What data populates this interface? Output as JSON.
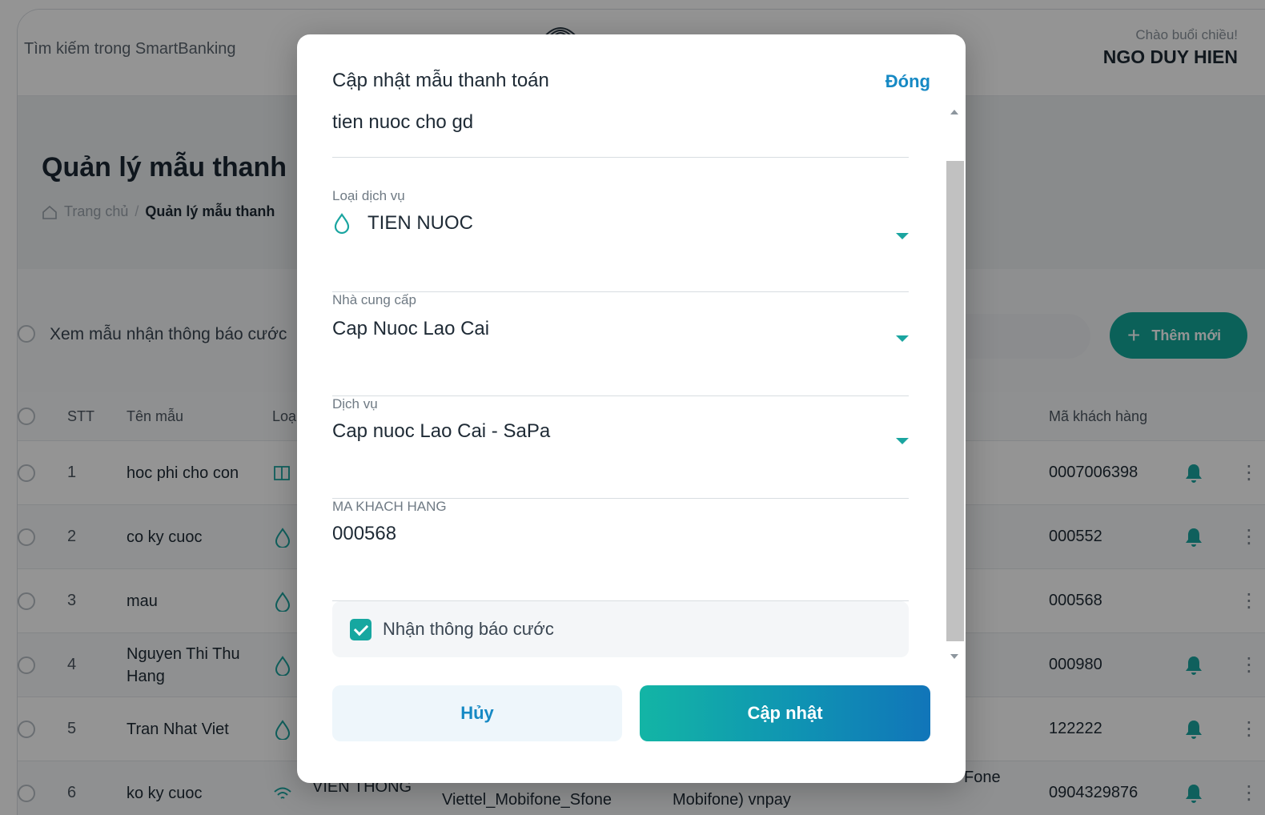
{
  "topbar": {
    "search_placeholder": "Tìm kiếm trong SmartBanking",
    "greeting": "Chào buổi chiều!",
    "user_name": "NGO DUY HIEN"
  },
  "page": {
    "title": "Quản lý mẫu thanh",
    "breadcrumb_home": "Trang chủ",
    "breadcrumb_sep": "/",
    "breadcrumb_current": "Quản lý mẫu thanh"
  },
  "filter": {
    "label": "Xem mẫu nhận thông báo cước",
    "add_button": "Thêm mới"
  },
  "table": {
    "headers": {
      "stt": "STT",
      "name": "Tên mẫu",
      "type": "Loạ",
      "code": "Mã khách hàng"
    },
    "rows": [
      {
        "stt": "1",
        "name": "hoc phi cho con",
        "type_icon": "book-icon",
        "code": "0007006398",
        "bell": true
      },
      {
        "stt": "2",
        "name": "co ky cuoc",
        "type_icon": "water-drop-icon",
        "code": "000552",
        "bell": true
      },
      {
        "stt": "3",
        "name": "mau",
        "type_icon": "water-drop-icon",
        "code": "000568",
        "bell": false
      },
      {
        "stt": "4",
        "name": "Nguyen Thi Thu Hang",
        "type_icon": "water-drop-icon",
        "code": "000980",
        "bell": true
      },
      {
        "stt": "5",
        "name": "Tran Nhat Viet",
        "type_icon": "water-drop-icon",
        "code": "122222",
        "bell": true
      },
      {
        "stt": "6",
        "name": "ko ky cuoc",
        "type_icon": "wifi-icon",
        "code": "0904329876",
        "bell": true
      }
    ],
    "row6_type": "VIEN THONG",
    "row6_provider": "Viettel_Mobifone_Sfone",
    "row6_service": "Mobifone) vnpay",
    "row6_extra": "Fone"
  },
  "modal": {
    "title": "Cập nhật mẫu thanh toán",
    "close_label": "Đóng",
    "template_name": "tien nuoc cho gd",
    "service_type_label": "Loại dịch vụ",
    "service_type_value": "TIEN NUOC",
    "service_type_icon": "water-drop-icon",
    "provider_label": "Nhà cung cấp",
    "provider_value": "Cap Nuoc Lao Cai",
    "service_label": "Dịch vụ",
    "service_value": "Cap nuoc Lao Cai - SaPa",
    "customer_code_label": "MA KHACH HANG",
    "customer_code_value": "000568",
    "notify_label": "Nhận thông báo cước",
    "notify_checked": true,
    "cancel_label": "Hủy",
    "update_label": "Cập nhật"
  },
  "colors": {
    "accent_teal": "#14a89a",
    "link_blue": "#1689c4",
    "update_gradient_start": "#13b5a5",
    "update_gradient_end": "#1175b9"
  }
}
